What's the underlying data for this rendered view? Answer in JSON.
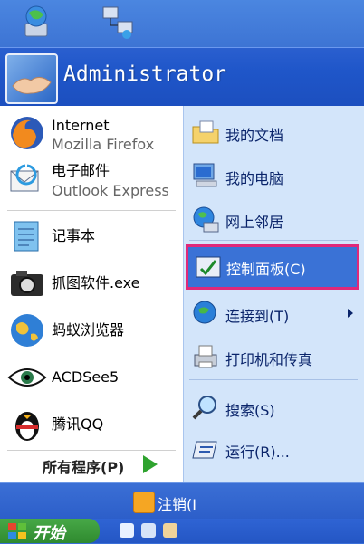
{
  "user": {
    "name": "Administrator"
  },
  "left_items": [
    {
      "title": "Internet",
      "subtitle": "Mozilla Firefox",
      "icon": "firefox-icon"
    },
    {
      "title": "电子邮件",
      "subtitle": "Outlook Express",
      "icon": "outlook-express-icon"
    },
    {
      "title": "记事本",
      "icon": "notepad-icon"
    },
    {
      "title": "抓图软件.exe",
      "icon": "camera-icon"
    },
    {
      "title": "蚂蚁浏览器",
      "icon": "globe-icon"
    },
    {
      "title": "ACDSee5",
      "icon": "eye-icon"
    },
    {
      "title": "腾讯QQ",
      "icon": "qq-penguin-icon"
    }
  ],
  "all_programs": "所有程序(P)",
  "right_items": [
    {
      "label": "我的文档",
      "icon": "my-documents-icon"
    },
    {
      "label": "我的电脑",
      "icon": "my-computer-icon"
    },
    {
      "label": "网上邻居",
      "icon": "network-places-icon"
    },
    {
      "label": "控制面板(C)",
      "icon": "control-panel-icon",
      "highlighted": true
    },
    {
      "label": "连接到(T)",
      "icon": "connect-to-icon",
      "has_submenu": true
    },
    {
      "label": "打印机和传真",
      "icon": "printer-icon"
    },
    {
      "label": "搜索(S)",
      "icon": "search-icon"
    },
    {
      "label": "运行(R)...",
      "icon": "run-icon"
    }
  ],
  "logoff": "注销(I",
  "start": "开始",
  "colors": {
    "highlight_border": "#e0287a",
    "highlight_bg": "#3a72d6",
    "header_blue": "#1f56c9"
  }
}
